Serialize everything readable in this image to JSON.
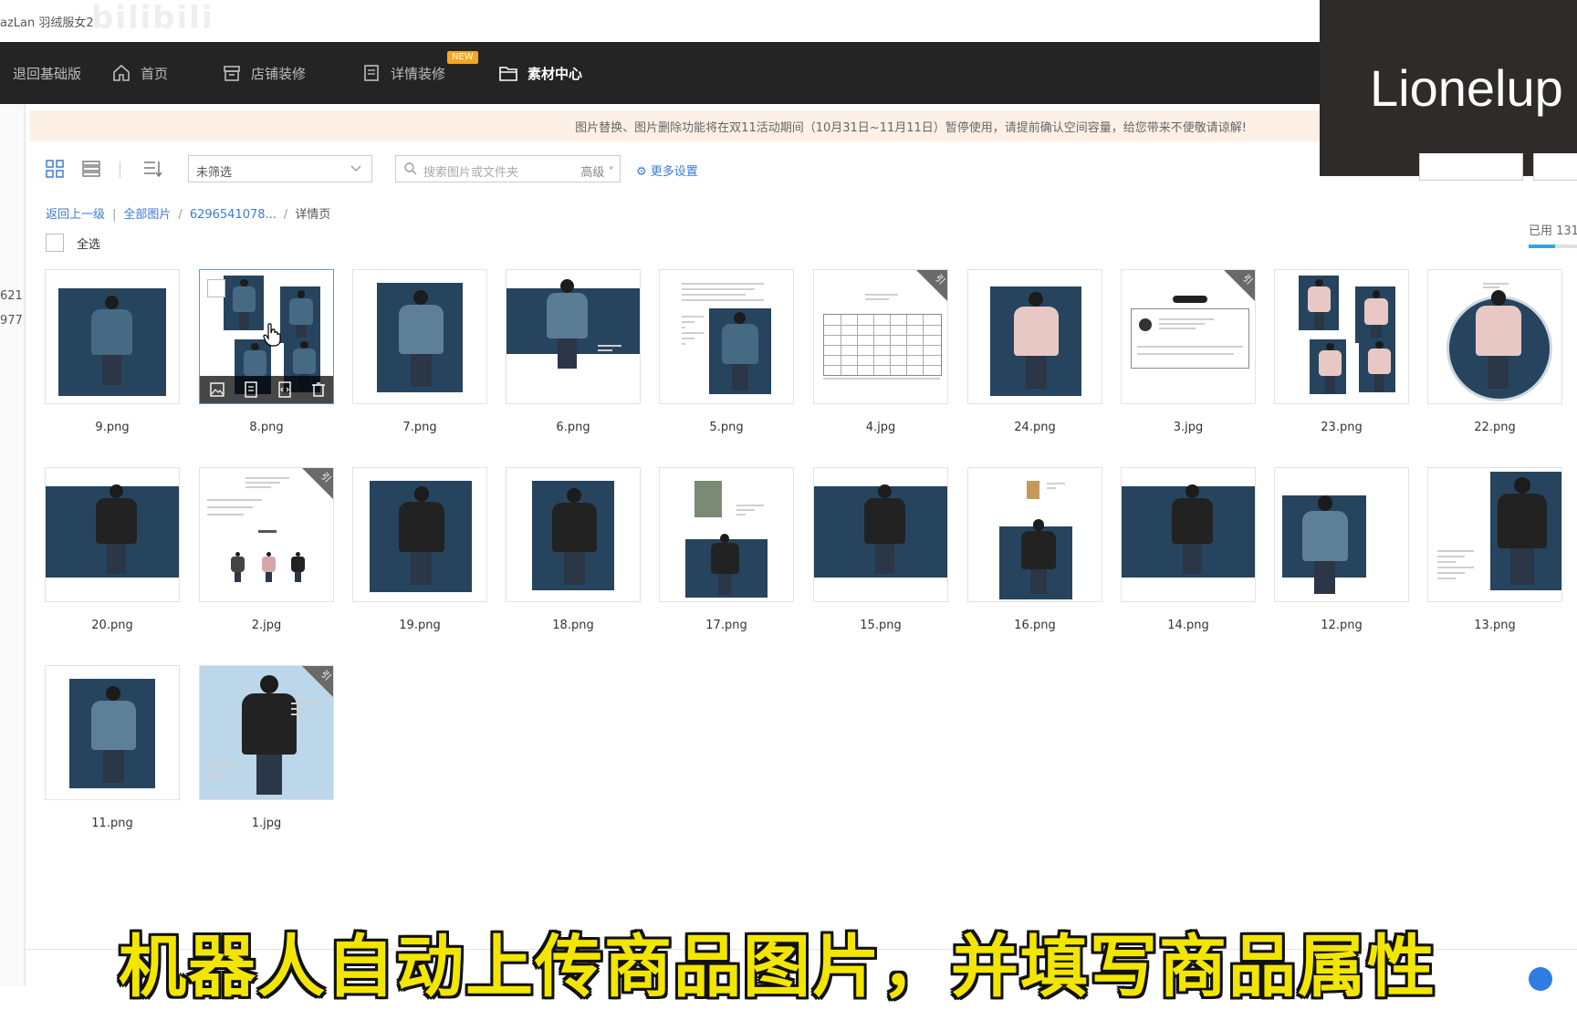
{
  "browser": {
    "tab_title": "azLan 羽绒服女2",
    "watermark": "bilibili"
  },
  "nav": {
    "items": [
      {
        "label": "退回基础版"
      },
      {
        "label": "首页",
        "icon": "home-icon"
      },
      {
        "label": "店铺装修",
        "icon": "store-icon"
      },
      {
        "label": "详情装修",
        "icon": "document-icon",
        "badge": "NEW"
      },
      {
        "label": "素材中心",
        "icon": "folder-icon",
        "active": true
      }
    ]
  },
  "overlay": {
    "name": "Lionelup"
  },
  "gutter": {
    "n1": "621",
    "n2": "977"
  },
  "notice": "图片替换、图片删除功能将在双11活动期间（10月31日~11月11日）暂停使用，请提前确认空间容量，给您带来不便敬请谅解!",
  "toolbar": {
    "filter_value": "未筛选",
    "search_placeholder": "搜索图片或文件夹",
    "advanced": "高级",
    "more_settings": "更多设置"
  },
  "breadcrumb": {
    "back": "返回上一级",
    "all": "全部图片",
    "folder": "6296541078...",
    "current": "详情页"
  },
  "usage": {
    "label": "已用 131",
    "fraction": 0.55
  },
  "select_all": "全选",
  "images": [
    {
      "name": "9.png",
      "kind": "photo-blue"
    },
    {
      "name": "8.png",
      "kind": "collage",
      "hover": true
    },
    {
      "name": "7.png",
      "kind": "photo-blue-tall"
    },
    {
      "name": "6.png",
      "kind": "photo-wide"
    },
    {
      "name": "5.png",
      "kind": "doc-photo"
    },
    {
      "name": "4.jpg",
      "kind": "table",
      "tag": "引"
    },
    {
      "name": "24.png",
      "kind": "photo-pink"
    },
    {
      "name": "3.jpg",
      "kind": "card",
      "tag": "引"
    },
    {
      "name": "23.png",
      "kind": "collage-pink"
    },
    {
      "name": "22.png",
      "kind": "circle"
    },
    {
      "name": "20.png",
      "kind": "photo-wide-dark"
    },
    {
      "name": "2.jpg",
      "kind": "info",
      "tag": "引"
    },
    {
      "name": "19.png",
      "kind": "photo-blue-dark"
    },
    {
      "name": "18.png",
      "kind": "photo-blue-tall-dark"
    },
    {
      "name": "17.png",
      "kind": "doc-split"
    },
    {
      "name": "15.png",
      "kind": "photo-wide-dark"
    },
    {
      "name": "16.png",
      "kind": "doc-bottom"
    },
    {
      "name": "14.png",
      "kind": "photo-wide-dark"
    },
    {
      "name": "12.png",
      "kind": "photo-side"
    },
    {
      "name": "13.png",
      "kind": "photo-right"
    },
    {
      "name": "11.png",
      "kind": "photo-blue-tall"
    },
    {
      "name": "1.jpg",
      "kind": "lightblue",
      "tag": "引"
    }
  ],
  "subtitle": "机器人自动上传商品图片，并填写商品属性"
}
